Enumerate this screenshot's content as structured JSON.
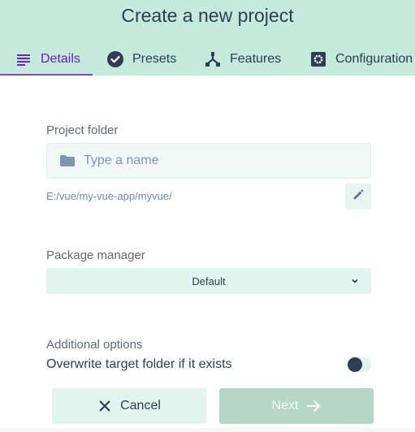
{
  "header": {
    "title": "Create a new project"
  },
  "tabs": [
    {
      "label": "Details",
      "icon": "list-icon",
      "active": true
    },
    {
      "label": "Presets",
      "icon": "check-circle-icon",
      "active": false
    },
    {
      "label": "Features",
      "icon": "features-icon",
      "active": false
    },
    {
      "label": "Configuration",
      "icon": "settings-icon",
      "active": false
    }
  ],
  "project_folder": {
    "label": "Project folder",
    "input_value": "",
    "placeholder": "Type a name",
    "path": "E:/vue/my-vue-app/myvue/"
  },
  "package_manager": {
    "label": "Package manager",
    "selected": "Default"
  },
  "additional_options": {
    "label": "Additional options",
    "overwrite_label": "Overwrite target folder if it exists",
    "overwrite_enabled": false
  },
  "actions": {
    "cancel_label": "Cancel",
    "next_label": "Next"
  },
  "colors": {
    "header_bg": "#c4eadc",
    "active_tab": "#6a1fbf",
    "tab_underline": "#8a48c8",
    "text": "#2c3e50",
    "next_button_bg": "#b6d6c8"
  }
}
